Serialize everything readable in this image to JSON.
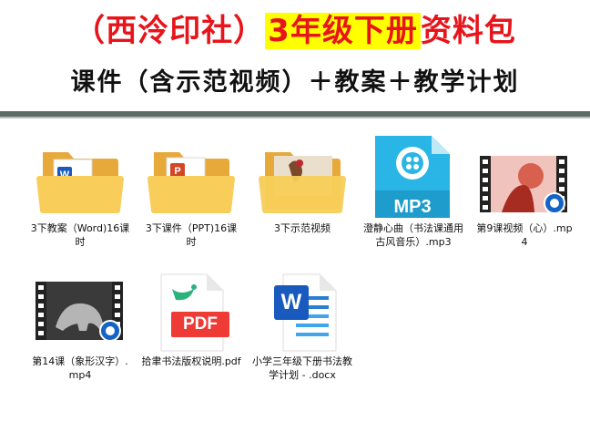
{
  "banner": {
    "title_prefix": "（西泠印社）",
    "title_highlight": "3年级下册",
    "title_suffix": "资料包",
    "subtitle": "课件（含示范视频）＋教案＋教学计划"
  },
  "colors": {
    "title_red": "#e8141b",
    "highlight": "#ffff00",
    "divider": "#5d6b67"
  },
  "files": [
    {
      "name": "3下教案（Word)16课时",
      "icon": "folder-word-icon"
    },
    {
      "name": "3下课件（PPT)16课时",
      "icon": "folder-ppt-icon"
    },
    {
      "name": "3下示范视频",
      "icon": "folder-video-icon"
    },
    {
      "name": "澄静心曲（书法课通用古风音乐）.mp3",
      "icon": "mp3-file-icon",
      "badge": "MP3"
    },
    {
      "name": "第9课视频（心）.mp4",
      "icon": "video-thumbnail-icon"
    },
    {
      "name": "第14课（象形汉字）.mp4",
      "icon": "video-thumbnail-icon"
    },
    {
      "name": "拾聿书法版权说明.pdf",
      "icon": "pdf-file-icon",
      "badge": "PDF"
    },
    {
      "name": "小学三年级下册书法教学计划 - .docx",
      "icon": "word-file-icon",
      "badge": "W"
    }
  ]
}
